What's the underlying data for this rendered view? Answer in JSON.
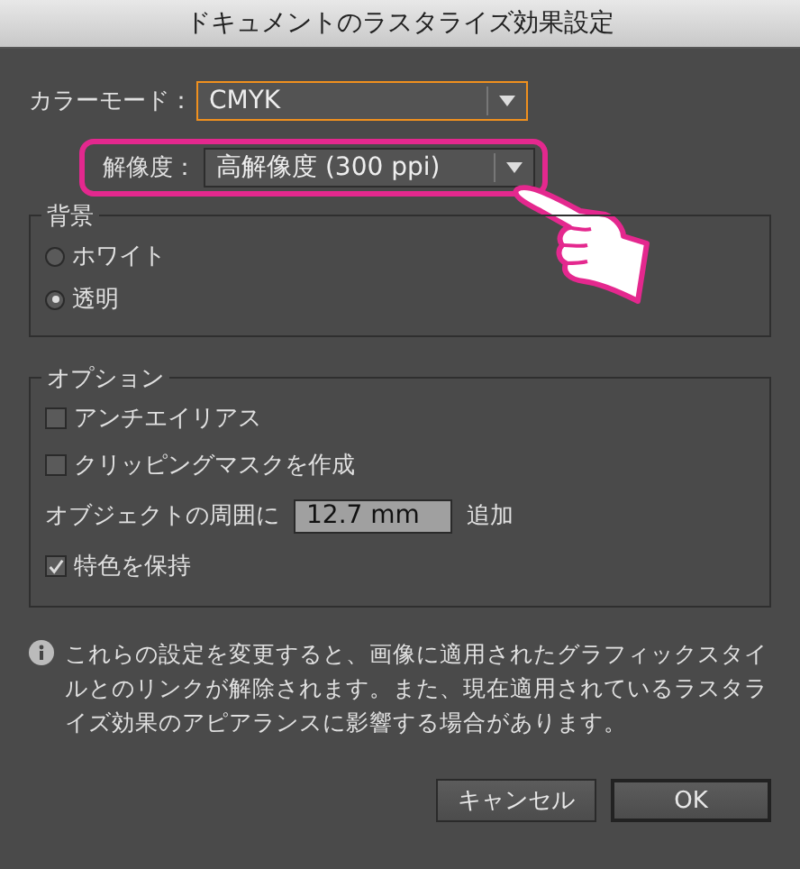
{
  "window": {
    "title": "ドキュメントのラスタライズ効果設定"
  },
  "color_mode": {
    "label": "カラーモード：",
    "value": "CMYK",
    "focused": true
  },
  "resolution": {
    "label": "解像度：",
    "value": "高解像度 (300 ppi)",
    "highlighted": true
  },
  "background": {
    "title": "背景",
    "options": [
      {
        "label": "ホワイト",
        "selected": false
      },
      {
        "label": "透明",
        "selected": true
      }
    ]
  },
  "options": {
    "title": "オプション",
    "items": [
      {
        "kind": "checkbox",
        "label": "アンチエイリアス",
        "checked": false
      },
      {
        "kind": "checkbox",
        "label": "クリッピングマスクを作成",
        "checked": false
      },
      {
        "kind": "field",
        "label": "オブジェクトの周囲に",
        "value": "12.7 mm",
        "suffix": "追加"
      },
      {
        "kind": "checkbox",
        "label": "特色を保持",
        "checked": true
      }
    ]
  },
  "info": "これらの設定を変更すると、画像に適用されたグラフィックスタイルとのリンクが解除されます。また、現在適用されているラスタライズ効果のアピアランスに影響する場合があります。",
  "buttons": [
    {
      "label": "キャンセル",
      "default": false
    },
    {
      "label": "OK",
      "default": true
    }
  ]
}
